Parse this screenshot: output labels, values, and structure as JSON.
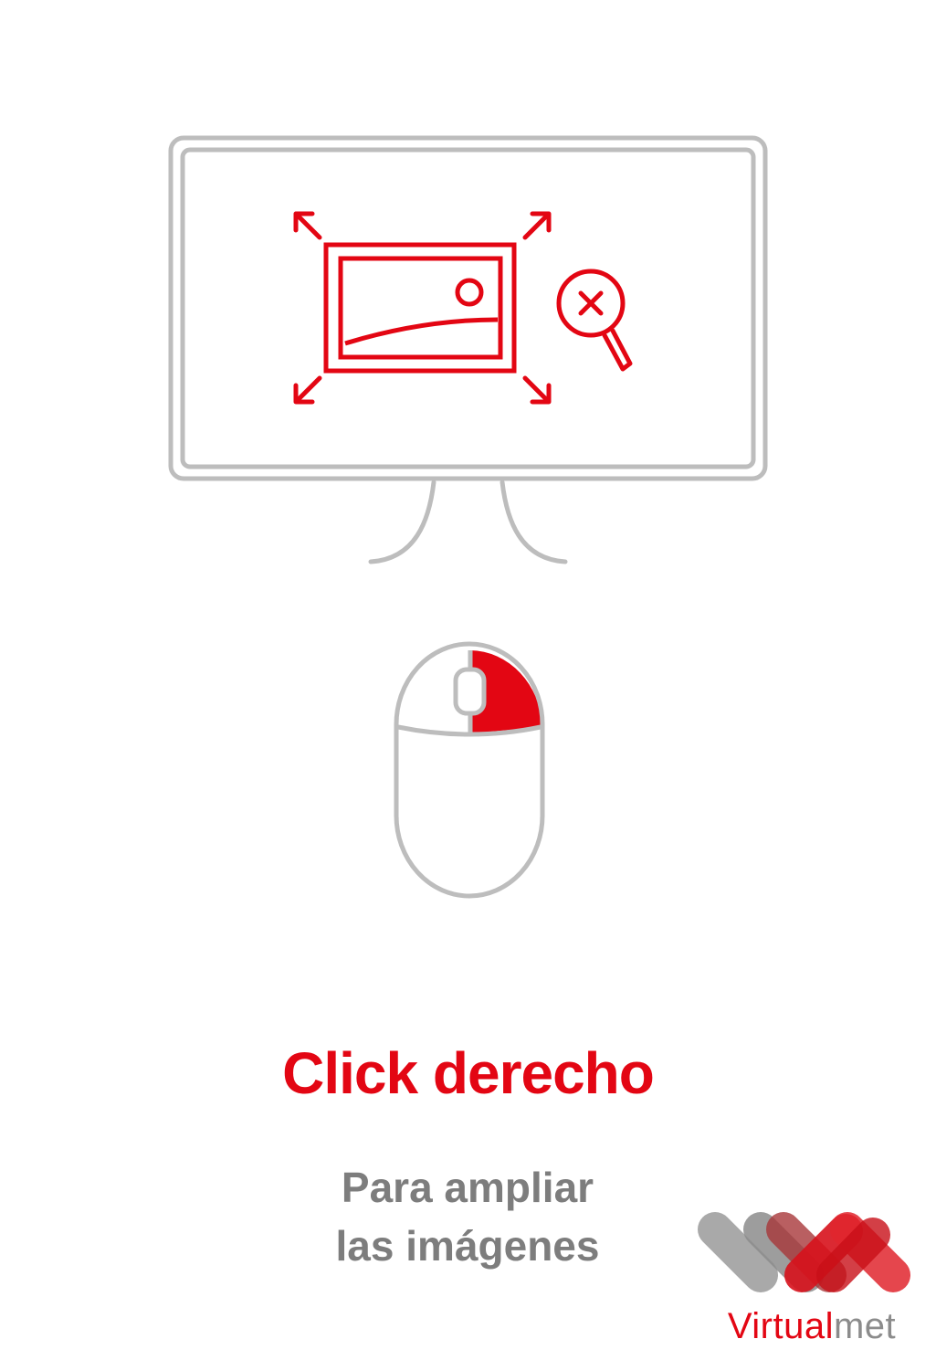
{
  "colors": {
    "accent": "#e30613",
    "outline": "#bdbdbd",
    "text_gray": "#7d7d7d"
  },
  "icons": [
    "monitor-icon",
    "expand-image-icon",
    "zoom-in-icon",
    "mouse-icon",
    "right-click-icon"
  ],
  "headline": "Click derecho",
  "subtitle": {
    "line1": "Para ampliar",
    "line2": "las imágenes"
  },
  "logo": {
    "part1": "Virtual",
    "part2": "met"
  }
}
